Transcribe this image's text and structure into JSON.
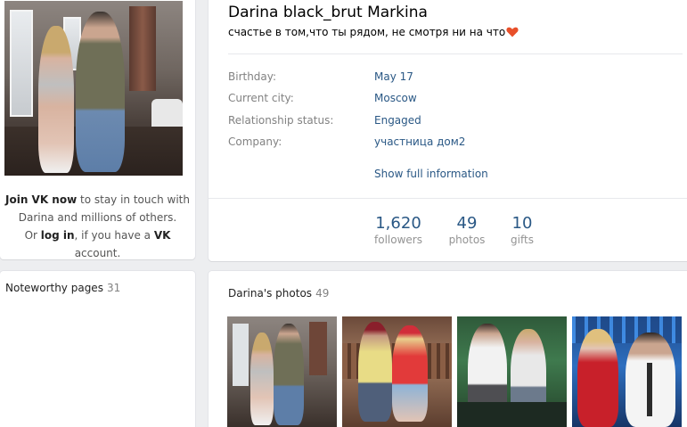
{
  "profile": {
    "name": "Darina black_brut Markina",
    "status": "счастье в том,что ты рядом, не смотря ни на что"
  },
  "join": {
    "line1_bold": "Join VK now",
    "line1_rest": " to stay in touch with",
    "line2": "Darina and millions of others.",
    "line3_pre": "Or ",
    "line3_login": "log in",
    "line3_mid": ", if you have a ",
    "line3_vk": "VK",
    "line3_end": " account."
  },
  "info": {
    "rows": [
      {
        "label": "Birthday:",
        "value": "May 17"
      },
      {
        "label": "Current city:",
        "value": "Moscow"
      },
      {
        "label": "Relationship status:",
        "value": "Engaged"
      },
      {
        "label": "Company:",
        "value": "участница дом2"
      }
    ],
    "show_full": "Show full information"
  },
  "counters": [
    {
      "num": "1,620",
      "label": "followers"
    },
    {
      "num": "49",
      "label": "photos"
    },
    {
      "num": "10",
      "label": "gifts"
    }
  ],
  "noteworthy": {
    "title": "Noteworthy pages",
    "count": "31"
  },
  "photos": {
    "title": "Darina's photos",
    "count": "49"
  },
  "colors": {
    "link": "#2a5885",
    "muted": "#828282",
    "page_bg": "#edeef0",
    "heart": "#e8502a"
  },
  "icons": {
    "heart": "heart-emoji-icon"
  }
}
